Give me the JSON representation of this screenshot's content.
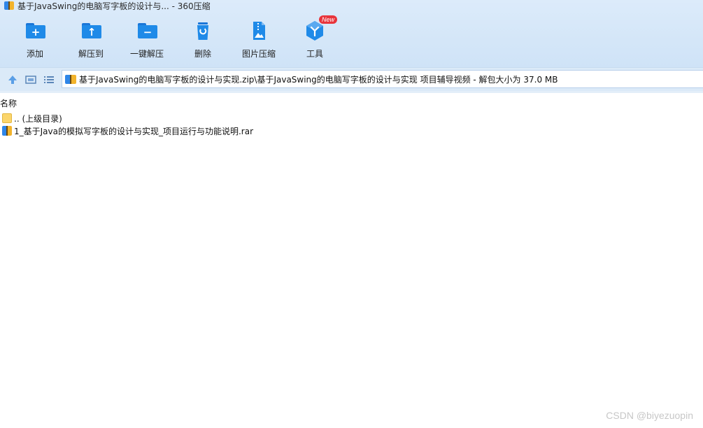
{
  "window": {
    "title": "基于JavaSwing的电脑写字板的设计与... - 360压缩"
  },
  "toolbar": {
    "items": [
      {
        "label": "添加",
        "icon": "add-icon"
      },
      {
        "label": "解压到",
        "icon": "extract-to-icon"
      },
      {
        "label": "一键解压",
        "icon": "one-click-extract-icon"
      },
      {
        "label": "删除",
        "icon": "delete-icon"
      },
      {
        "label": "图片压缩",
        "icon": "image-compress-icon"
      },
      {
        "label": "工具",
        "icon": "tools-icon",
        "badge": "New"
      }
    ]
  },
  "address": {
    "path": "基于JavaSwing的电脑写字板的设计与实现.zip\\基于JavaSwing的电脑写字板的设计与实现   项目辅导视频 - 解包大小为 37.0 MB"
  },
  "list": {
    "column_name": "名称",
    "rows": [
      {
        "name": ".. (上级目录)",
        "icon": "folder-icon"
      },
      {
        "name": "1_基于Java的模拟写字板的设计与实现_项目运行与功能说明.rar",
        "icon": "rar-archive-icon"
      }
    ]
  },
  "watermark": "CSDN @biyezuopin",
  "colors": {
    "accent": "#1f8ae8",
    "toolbar_bg": "#d6e8f9",
    "new_badge": "#e8343b"
  }
}
